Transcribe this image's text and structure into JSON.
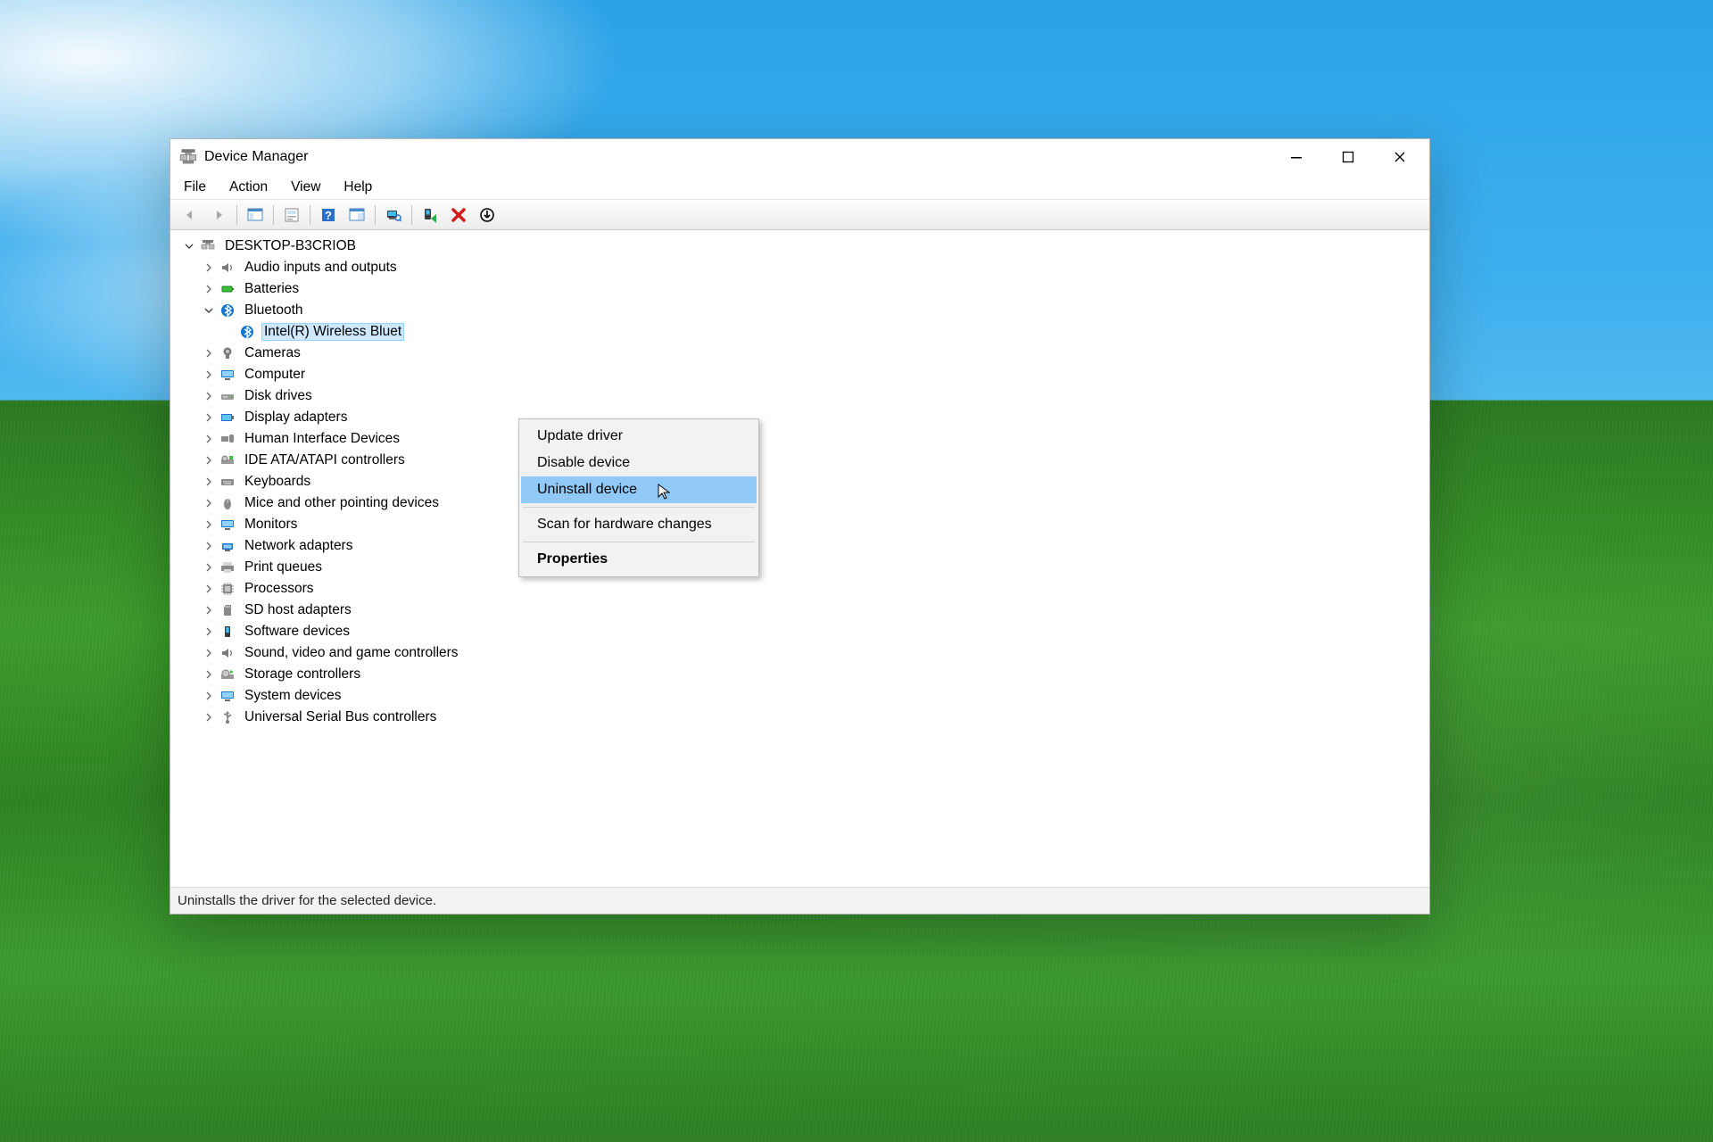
{
  "window": {
    "title": "Device Manager"
  },
  "menubar": {
    "file": "File",
    "action": "Action",
    "view": "View",
    "help": "Help"
  },
  "toolbar": {
    "back": "back-icon",
    "forward": "forward-icon"
  },
  "tree": {
    "root": "DESKTOP-B3CRIOB",
    "categories": {
      "0": {
        "label": "Audio inputs and outputs"
      },
      "1": {
        "label": "Batteries"
      },
      "2": {
        "label": "Bluetooth"
      },
      "3": {
        "label": "Cameras"
      },
      "4": {
        "label": "Computer"
      },
      "5": {
        "label": "Disk drives"
      },
      "6": {
        "label": "Display adapters"
      },
      "7": {
        "label": "Human Interface Devices"
      },
      "8": {
        "label": "IDE ATA/ATAPI controllers"
      },
      "9": {
        "label": "Keyboards"
      },
      "10": {
        "label": "Mice and other pointing devices"
      },
      "11": {
        "label": "Monitors"
      },
      "12": {
        "label": "Network adapters"
      },
      "13": {
        "label": "Print queues"
      },
      "14": {
        "label": "Processors"
      },
      "15": {
        "label": "SD host adapters"
      },
      "16": {
        "label": "Software devices"
      },
      "17": {
        "label": "Sound, video and game controllers"
      },
      "18": {
        "label": "Storage controllers"
      },
      "19": {
        "label": "System devices"
      },
      "20": {
        "label": "Universal Serial Bus controllers"
      }
    },
    "bluetooth_child": "Intel(R) Wireless Bluet"
  },
  "context_menu": {
    "update": "Update driver",
    "disable": "Disable device",
    "uninstall": "Uninstall device",
    "scan": "Scan for hardware changes",
    "properties": "Properties"
  },
  "statusbar": {
    "text": "Uninstalls the driver for the selected device."
  }
}
